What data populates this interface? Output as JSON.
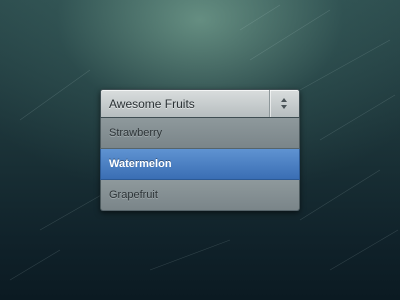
{
  "dropdown": {
    "selected_label": "Awesome Fruits",
    "arrow_icon": "up-down-chevron-icon",
    "options": [
      {
        "label": "Strawberry",
        "selected": false
      },
      {
        "label": "Watermelon",
        "selected": true
      },
      {
        "label": "Grapefruit",
        "selected": false
      }
    ]
  },
  "colors": {
    "highlight": "#4a80c4",
    "background": "#1c3439"
  }
}
